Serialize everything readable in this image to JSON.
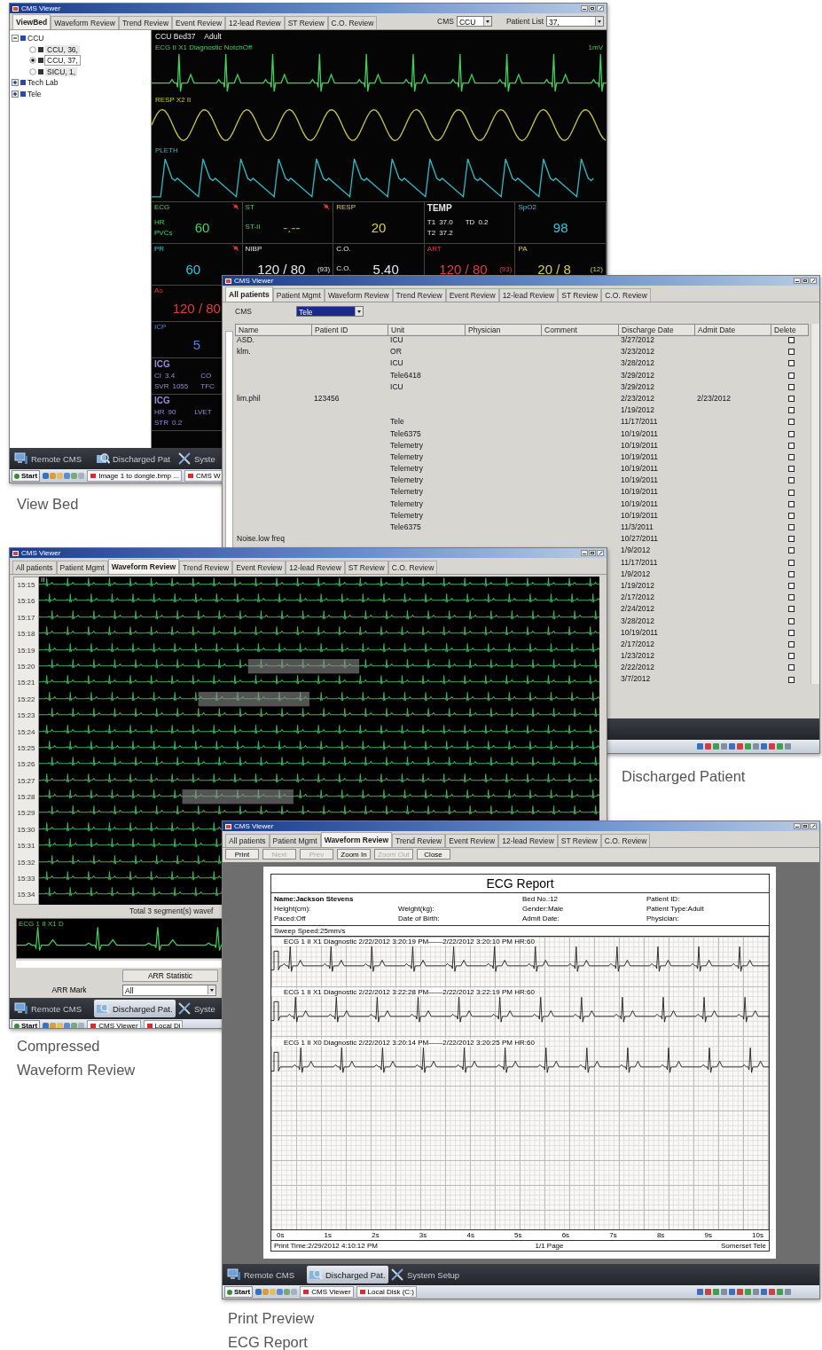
{
  "windows": [
    {
      "kind": "view_bed",
      "title": "CMS Viewer",
      "tabs": [
        {
          "label": "ViewBed",
          "selected": true
        },
        {
          "label": "Waveform Review",
          "selected": false
        },
        {
          "label": "Trend Review",
          "selected": false
        },
        {
          "label": "Event Review",
          "selected": false
        },
        {
          "label": "12-lead Review",
          "selected": false
        },
        {
          "label": "ST Review",
          "selected": false
        },
        {
          "label": "C.O. Review",
          "selected": false
        }
      ],
      "cms_label": "CMS",
      "cms_value": "CCU",
      "patient_list_label": "Patient List",
      "patient_list_value": "37,",
      "tree": [
        {
          "label": "CCU",
          "expanded": true,
          "children": [
            {
              "label": "CCU, 36,",
              "selected": false
            },
            {
              "label": "CCU, 37,",
              "selected": true
            },
            {
              "label": "SICU, 1,",
              "selected": false
            }
          ]
        },
        {
          "label": "Tech Lab",
          "expanded": false
        },
        {
          "label": "Tele",
          "expanded": false
        }
      ],
      "monitor": {
        "bed": "CCU Bed37",
        "patient_type": "Adult",
        "waves": [
          {
            "kind": "ecg",
            "label": "ECG II X1 Diagnostic NotchOff",
            "scale": "1mV",
            "color": "#3fcf5a"
          },
          {
            "kind": "resp",
            "label": "RESP X2 II",
            "color": "#c9c646"
          },
          {
            "kind": "pleth",
            "label": "PLETH",
            "color": "#2fb8c0"
          }
        ],
        "vitals": [
          {
            "label": "ECG",
            "color": "#3fd45e",
            "value": "60",
            "readings": [
              {
                "label": "HR"
              },
              {
                "label": "PVCs"
              }
            ],
            "alarm_off": true
          },
          {
            "label": "ST",
            "color": "#3fd45e",
            "value": "-.--",
            "readings": [
              {
                "label": "ST-II"
              }
            ],
            "alarm_off": true
          },
          {
            "label": "RESP",
            "color": "#d8d040",
            "value": "20",
            "alarm_off": false
          },
          {
            "label": "TEMP",
            "color": "#e8e8e8",
            "readings": [
              {
                "label": "T1",
                "value": "37.0"
              },
              {
                "label": "T2",
                "value": "37.2"
              },
              {
                "label": "TD",
                "value": "0.2"
              }
            ],
            "alarm_off": false
          },
          {
            "label": "SpO2",
            "color": "#30c8d8",
            "value": "98",
            "alarm_off": false
          },
          {
            "label": "PR",
            "color": "#30c8d8",
            "value": "60",
            "alarm_off": true
          },
          {
            "label": "NIBP",
            "color": "#e8e8e8",
            "value": "120 / 80",
            "suffix": "(93)",
            "alarm_off": false
          },
          {
            "label": "C.O.",
            "color": "#e8e8e8",
            "value": "5.40",
            "readings": [
              {
                "label": "C.O."
              }
            ],
            "alarm_off": false
          },
          {
            "label": "ART",
            "color": "#e83a3a",
            "value": "120 / 80",
            "suffix": "(93)",
            "alarm_off": false
          },
          {
            "label": "PA",
            "color": "#d8d040",
            "value": "20 / 8",
            "suffix": "(12)",
            "alarm_off": false
          }
        ],
        "side_vitals": [
          {
            "label": "Ao",
            "color": "#e83a3a",
            "value": "120 / 80",
            "alarm_off": false
          },
          {
            "label": "ICP",
            "color": "#5a7fe0",
            "value": "5",
            "alarm_off": false
          },
          {
            "label": "ICG",
            "color": "#9a8ad8",
            "readings": [
              {
                "label": "CI",
                "value": "3.4"
              },
              {
                "label": "SVR",
                "value": "1055"
              },
              {
                "label": "CO"
              },
              {
                "label": "TFC"
              }
            ],
            "alarm_off": false
          },
          {
            "label": "ICG",
            "color": "#9a8ad8",
            "readings": [
              {
                "label": "HR",
                "value": "90"
              },
              {
                "label": "STR",
                "value": "0.2"
              },
              {
                "label": "LVET"
              }
            ],
            "alarm_off": false
          }
        ]
      },
      "taskbar": [
        {
          "kind": "remote",
          "label": "Remote CMS",
          "selected": false
        },
        {
          "kind": "discharged",
          "label": "Discharged Pat",
          "selected": false
        },
        {
          "kind": "setup",
          "label": "Syste",
          "selected": false
        }
      ],
      "start_bar": {
        "start": "Start",
        "tasks": [
          "Image 1 to dongle.bmp ...",
          "CMS W"
        ]
      }
    },
    {
      "kind": "discharged",
      "title": "CMS Viewer",
      "tabs": [
        {
          "label": "All patients",
          "selected": true
        },
        {
          "label": "Patient Mgmt",
          "selected": false
        },
        {
          "label": "Waveform Review",
          "selected": false
        },
        {
          "label": "Trend Review",
          "selected": false
        },
        {
          "label": "Event Review",
          "selected": false
        },
        {
          "label": "12-lead Review",
          "selected": false
        },
        {
          "label": "ST Review",
          "selected": false
        },
        {
          "label": "C.O. Review",
          "selected": false
        }
      ],
      "cms_label": "CMS",
      "cms_value": "Tele",
      "columns": [
        "Name",
        "Patient ID",
        "Unit",
        "Physician",
        "Comment",
        "Discharge Date",
        "Admit Date",
        "Delete"
      ],
      "rows": [
        {
          "name": "ASD.",
          "unit": "ICU",
          "discharge_date": "3/27/2012",
          "checked": false
        },
        {
          "name": "klm.",
          "unit": "OR",
          "discharge_date": "3/23/2012",
          "checked": false
        },
        {
          "unit": "ICU",
          "discharge_date": "3/28/2012",
          "checked": false
        },
        {
          "unit": "Tele6418",
          "discharge_date": "3/29/2012",
          "checked": false
        },
        {
          "unit": "ICU",
          "discharge_date": "3/29/2012",
          "checked": false
        },
        {
          "name": "lim.phil",
          "patient_id": "123456",
          "discharge_date": "2/23/2012",
          "admit_date": "2/23/2012",
          "checked": false
        },
        {
          "discharge_date": "1/19/2012",
          "checked": false
        },
        {
          "unit": "Tele",
          "discharge_date": "11/17/2011",
          "checked": false
        },
        {
          "unit": "Tele6375",
          "discharge_date": "10/19/2011",
          "checked": false
        },
        {
          "unit": "Telemetry",
          "discharge_date": "10/19/2011",
          "checked": false
        },
        {
          "unit": "Telemetry",
          "discharge_date": "10/19/2011",
          "checked": false
        },
        {
          "unit": "Telemetry",
          "discharge_date": "10/19/2011",
          "checked": false
        },
        {
          "unit": "Telemetry",
          "discharge_date": "10/19/2011",
          "checked": false
        },
        {
          "unit": "Telemetry",
          "discharge_date": "10/19/2011",
          "checked": false
        },
        {
          "unit": "Telemetry",
          "discharge_date": "10/19/2011",
          "checked": false
        },
        {
          "unit": "Telemetry",
          "discharge_date": "10/19/2011",
          "checked": false
        },
        {
          "unit": "Tele6375",
          "discharge_date": "11/3/2011",
          "checked": false
        },
        {
          "name": "Noise.low freq",
          "discharge_date": "10/27/2011",
          "checked": false
        },
        {
          "discharge_date": "1/9/2012",
          "checked": false
        },
        {
          "discharge_date": "11/17/2011",
          "checked": false
        },
        {
          "discharge_date": "1/9/2012",
          "checked": false
        },
        {
          "discharge_date": "1/19/2012",
          "checked": false
        },
        {
          "discharge_date": "2/17/2012",
          "checked": false
        },
        {
          "discharge_date": "2/24/2012",
          "checked": false
        },
        {
          "discharge_date": "3/28/2012",
          "checked": false
        },
        {
          "discharge_date": "10/19/2011",
          "checked": false
        },
        {
          "discharge_date": "2/17/2012",
          "checked": false
        },
        {
          "discharge_date": "1/23/2012",
          "checked": false
        },
        {
          "discharge_date": "2/22/2012",
          "checked": false
        },
        {
          "discharge_date": "3/7/2012",
          "checked": false
        }
      ],
      "start_bar": {
        "tray": true
      }
    },
    {
      "kind": "compressed",
      "title": "CMS Viewer",
      "tabs": [
        {
          "label": "All patients",
          "selected": false
        },
        {
          "label": "Patient Mgmt",
          "selected": false
        },
        {
          "label": "Waveform Review",
          "selected": true
        },
        {
          "label": "Trend Review",
          "selected": false
        },
        {
          "label": "Event Review",
          "selected": false
        },
        {
          "label": "12-lead Review",
          "selected": false
        },
        {
          "label": "ST Review",
          "selected": false
        },
        {
          "label": "C.O. Review",
          "selected": false
        }
      ],
      "lead": "II",
      "rows": [
        {
          "time": "15:15",
          "highlighted": false
        },
        {
          "time": "15:16",
          "highlighted": false
        },
        {
          "time": "15:17",
          "highlighted": false
        },
        {
          "time": "15:18",
          "highlighted": false
        },
        {
          "time": "15:19",
          "highlighted": false
        },
        {
          "time": "15:20",
          "highlighted": true
        },
        {
          "time": "15:21",
          "highlighted": false
        },
        {
          "time": "15:22",
          "highlighted": true
        },
        {
          "time": "15:23",
          "highlighted": false
        },
        {
          "time": "15:24",
          "highlighted": false
        },
        {
          "time": "15:25",
          "highlighted": false
        },
        {
          "time": "15:26",
          "highlighted": false
        },
        {
          "time": "15:27",
          "highlighted": false
        },
        {
          "time": "15:28",
          "highlighted": true
        },
        {
          "time": "15:29",
          "highlighted": false
        },
        {
          "time": "15:30",
          "highlighted": false
        },
        {
          "time": "15:31",
          "highlighted": false
        },
        {
          "time": "15:32",
          "highlighted": false
        },
        {
          "time": "15:33",
          "highlighted": false
        },
        {
          "time": "15:34",
          "highlighted": false
        }
      ],
      "summary": "Total 3 segment(s) wavef",
      "strip_label": "ECG 1 II X1 D",
      "arr_statistic": "ARR Statistic",
      "arr_mark_label": "ARR Mark",
      "arr_mark_value": "All",
      "taskbar": [
        {
          "kind": "remote",
          "label": "Remote CMS",
          "selected": false
        },
        {
          "kind": "discharged",
          "label": "Discharged Pat.",
          "selected": true
        },
        {
          "kind": "setup",
          "label": "Syste",
          "selected": false
        }
      ],
      "start_bar": {
        "start": "Start",
        "tasks": [
          "CMS Viewer",
          "Local Di"
        ]
      }
    },
    {
      "kind": "print_preview",
      "title": "CMS Viewer",
      "tabs": [
        {
          "label": "All patients",
          "selected": false
        },
        {
          "label": "Patient Mgmt",
          "selected": false
        },
        {
          "label": "Waveform Review",
          "selected": true
        },
        {
          "label": "Trend Review",
          "selected": false
        },
        {
          "label": "Event Review",
          "selected": false
        },
        {
          "label": "12-lead Review",
          "selected": false
        },
        {
          "label": "ST Review",
          "selected": false
        },
        {
          "label": "C.O. Review",
          "selected": false
        }
      ],
      "toolbar": [
        {
          "label": "Print",
          "disabled": false
        },
        {
          "label": "Next",
          "disabled": true
        },
        {
          "label": "Prev",
          "disabled": true
        },
        {
          "label": "Zoom In",
          "disabled": false
        },
        {
          "label": "Zoom Out",
          "disabled": true
        },
        {
          "label": "Close",
          "disabled": false
        }
      ],
      "report": {
        "title": "ECG Report",
        "name": "Name:Jackson Stevens",
        "fields": [
          "Bed No.:12",
          "Patient ID:",
          "Height(cm):",
          "Weight(kg):",
          "Gender:Male",
          "Patient Type:Adult",
          "Paced:Off",
          "Date of Birth:",
          "Admit Date:",
          "Physician:"
        ],
        "sweep": "Sweep Speed:25mm/s",
        "strips": [
          "ECG 1 II X1 Diagnostic 2/22/2012 3:20:19 PM——2/22/2012 3:20:10 PM HR:60",
          "ECG 1 II X1 Diagnostic 2/22/2012 3:22:28 PM——2/22/2012 3:22:19 PM HR:60",
          "ECG 1 II X0 Diagnostic 2/22/2012 3:20:14 PM——2/22/2012 3:20:25 PM HR:60"
        ],
        "time_labels": [
          "0s",
          "1s",
          "2s",
          "3s",
          "4s",
          "5s",
          "6s",
          "7s",
          "8s",
          "9s",
          "10s"
        ],
        "footer_left": "Print Time:2/29/2012 4:10:12 PM",
        "footer_center": "1/1 Page",
        "footer_right": "Somerset Tele"
      },
      "taskbar": [
        {
          "kind": "remote",
          "label": "Remote CMS",
          "selected": false
        },
        {
          "kind": "discharged",
          "label": "Discharged Pat.",
          "selected": true
        },
        {
          "kind": "setup",
          "label": "System Setup",
          "selected": false
        }
      ],
      "start_bar": {
        "start": "Start",
        "tasks": [
          "CMS Viewer",
          "Local Disk (C:)"
        ],
        "tray": true
      }
    }
  ],
  "captions": [
    {
      "lines": [
        "View Bed"
      ]
    },
    {
      "lines": [
        "Discharged Patient"
      ]
    },
    {
      "lines": [
        "Compressed",
        "Waveform Review"
      ]
    },
    {
      "lines": [
        "Print Preview",
        "ECG Report"
      ]
    }
  ]
}
